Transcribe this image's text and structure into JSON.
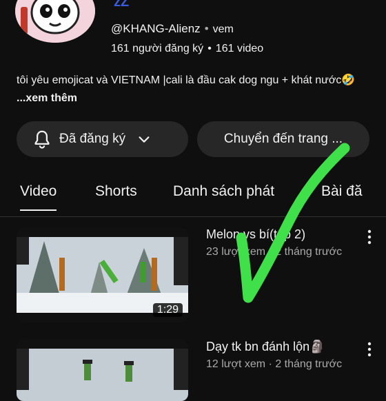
{
  "channel": {
    "avatar_icon": "cat-avatar-icon",
    "zz_mark": "zZ",
    "handle": "@KHANG-Alienz",
    "handle_tag": "vem",
    "subscribers": "161 người đăng ký",
    "video_count": "161 video",
    "description": "tôi yêu emojicat và VIETNAM |cali là đầu cak dog ngu + khát nước🤣",
    "more_label": "...xem thêm"
  },
  "actions": {
    "subscribed_label": "Đã đăng ký",
    "goto_label": "Chuyển đến trang ..."
  },
  "tabs": [
    "Video",
    "Shorts",
    "Danh sách phát",
    "Bài đă"
  ],
  "videos": [
    {
      "title": "Melon vs bí(tập 2)",
      "meta": "23 lượt xem · 2 tháng trước",
      "duration": "1:29"
    },
    {
      "title": "Dạy tk bn đánh lộn🗿",
      "meta": "12 lượt xem · 2 tháng trước",
      "duration": ""
    }
  ],
  "colors": {
    "background": "#0f0f0f",
    "button_bg": "#272727",
    "checkmark": "#3fe049"
  }
}
